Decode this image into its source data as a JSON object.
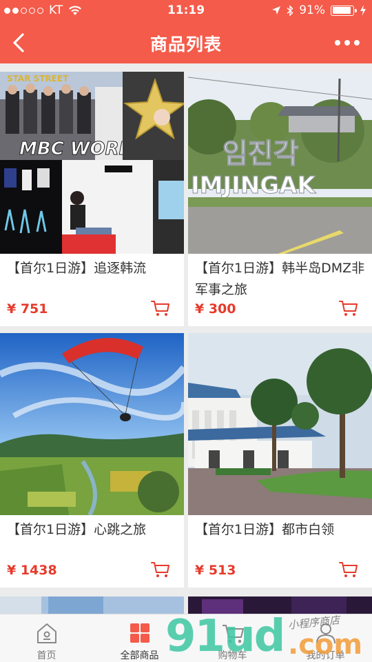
{
  "status": {
    "carrier": "KT",
    "time": "11:19",
    "battery": "91%",
    "battery_level": 0.91
  },
  "header": {
    "title": "商品列表"
  },
  "products": [
    {
      "name": "【首尔1日游】追逐韩流",
      "price": "¥ 751"
    },
    {
      "name": "【首尔1日游】韩半岛DMZ非军事之旅",
      "price": "¥ 300"
    },
    {
      "name": "【首尔1日游】心跳之旅",
      "price": "¥ 1438"
    },
    {
      "name": "【首尔1日游】都市白领",
      "price": "¥ 513"
    }
  ],
  "images": {
    "p1_sign": "MBC WORLD",
    "p1_star": "STAR STREET",
    "p2_hangul": "임진각",
    "p2_latin": "IMJINGAK"
  },
  "tabs": [
    {
      "label": "首页"
    },
    {
      "label": "全部商品"
    },
    {
      "label": "购物车"
    },
    {
      "label": "我的订单"
    }
  ],
  "watermark": {
    "brand": "91ud",
    "tld": ".com",
    "tagline": "小程序商店"
  },
  "colors": {
    "brand": "#f45b4a",
    "price": "#e63a2b"
  }
}
